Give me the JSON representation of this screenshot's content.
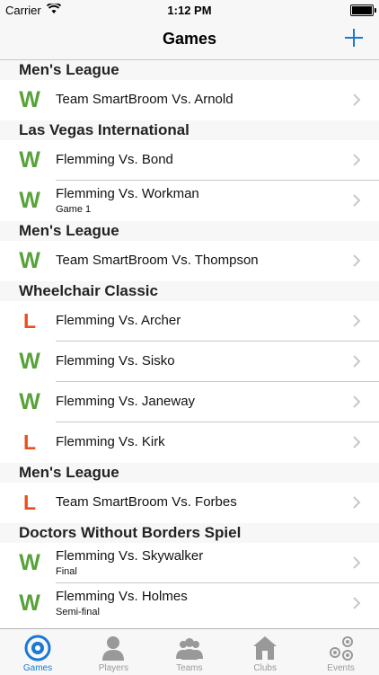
{
  "status": {
    "carrier": "Carrier",
    "time": "1:12 PM"
  },
  "nav": {
    "title": "Games"
  },
  "sections": [
    {
      "header": "Men's League",
      "rows": [
        {
          "result": "W",
          "title": "Team SmartBroom Vs. Arnold",
          "subtitle": ""
        }
      ]
    },
    {
      "header": "Las Vegas International",
      "rows": [
        {
          "result": "W",
          "title": "Flemming Vs. Bond",
          "subtitle": ""
        },
        {
          "result": "W",
          "title": "Flemming Vs. Workman",
          "subtitle": "Game 1"
        }
      ]
    },
    {
      "header": "Men's League",
      "rows": [
        {
          "result": "W",
          "title": "Team SmartBroom Vs. Thompson",
          "subtitle": ""
        }
      ]
    },
    {
      "header": "Wheelchair Classic",
      "rows": [
        {
          "result": "L",
          "title": "Flemming Vs. Archer",
          "subtitle": ""
        },
        {
          "result": "W",
          "title": "Flemming Vs. Sisko",
          "subtitle": ""
        },
        {
          "result": "W",
          "title": "Flemming Vs. Janeway",
          "subtitle": ""
        },
        {
          "result": "L",
          "title": "Flemming Vs. Kirk",
          "subtitle": ""
        }
      ]
    },
    {
      "header": "Men's League",
      "rows": [
        {
          "result": "L",
          "title": "Team SmartBroom Vs. Forbes",
          "subtitle": ""
        }
      ]
    },
    {
      "header": "Doctors Without Borders Spiel",
      "rows": [
        {
          "result": "W",
          "title": "Flemming Vs. Skywalker",
          "subtitle": "Final"
        },
        {
          "result": "W",
          "title": "Flemming Vs. Holmes",
          "subtitle": "Semi-final"
        }
      ]
    }
  ],
  "tabs": [
    {
      "label": "Games",
      "icon": "target-icon",
      "active": true
    },
    {
      "label": "Players",
      "icon": "person-icon",
      "active": false
    },
    {
      "label": "Teams",
      "icon": "people-icon",
      "active": false
    },
    {
      "label": "Clubs",
      "icon": "house-icon",
      "active": false
    },
    {
      "label": "Events",
      "icon": "stones-icon",
      "active": false
    }
  ],
  "colors": {
    "accent": "#1a78d6",
    "win": "#58a23a",
    "loss": "#e8501e"
  }
}
